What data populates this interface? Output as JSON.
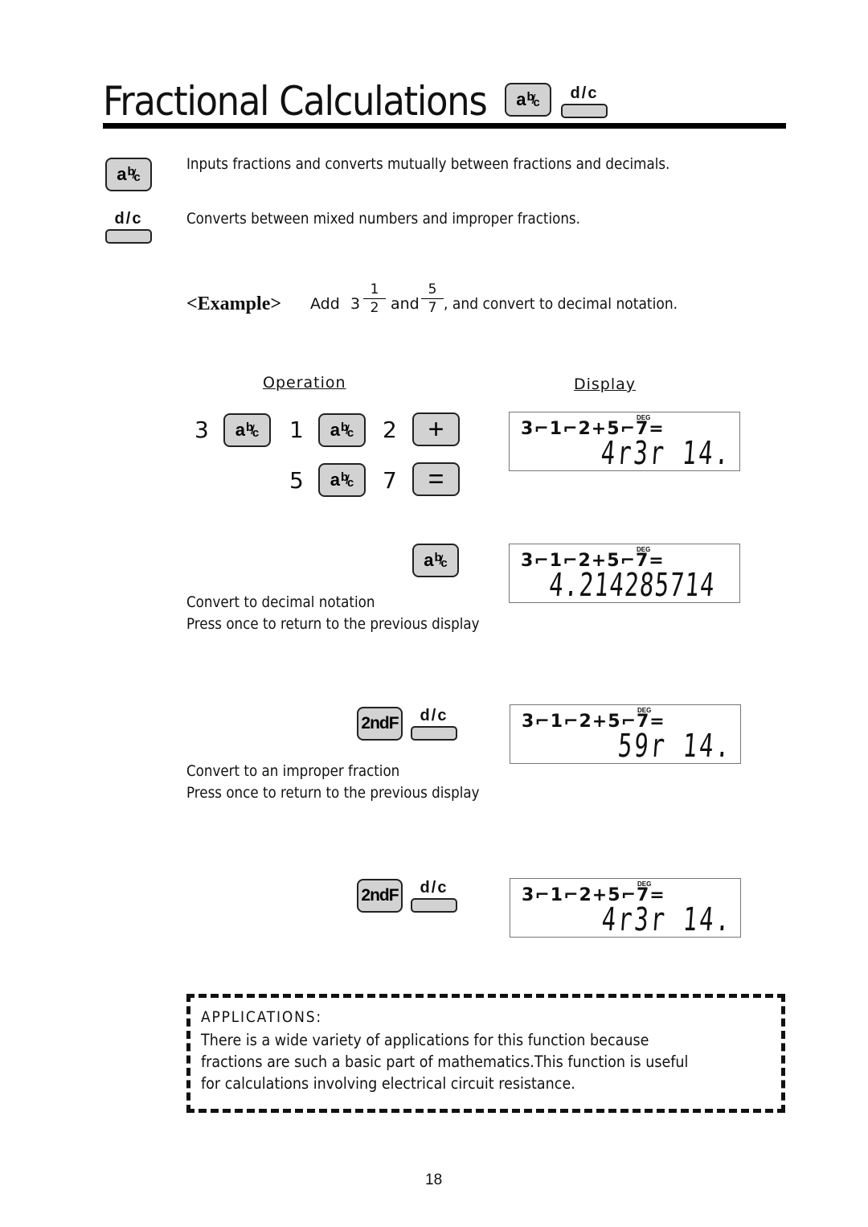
{
  "header": {
    "title": "Fractional Calculations",
    "key_abc": {
      "a": "a",
      "b": "b",
      "slash": "/",
      "c": "c"
    },
    "key_dc": "d/c"
  },
  "definitions": [
    {
      "key": "a b/c",
      "text": "Inputs fractions and converts mutually between fractions and decimals."
    },
    {
      "key": "d/c",
      "text": "Converts between mixed numbers and improper fractions."
    }
  ],
  "example": {
    "label": "<Example>",
    "add": "Add",
    "whole": "3",
    "frac1": {
      "num": "1",
      "den": "2"
    },
    "and": "and",
    "frac2": {
      "num": "5",
      "den": "7"
    },
    "tail": ", and convert to decimal notation."
  },
  "columns": {
    "operation": "Operation",
    "display": "Display"
  },
  "operation": {
    "row1": [
      "3",
      "1",
      "2"
    ],
    "row2": [
      "5",
      "7"
    ],
    "plus": "+",
    "equals": "=",
    "second_f": "2ndF"
  },
  "steps": [
    {
      "display": {
        "indicator": "DEG",
        "line1": "3⌐1⌐2+5⌐7=",
        "line2": "4r3r 14."
      }
    },
    {
      "display": {
        "indicator": "DEG",
        "line1": "3⌐1⌐2+5⌐7=",
        "line2": "4.214285714"
      },
      "notes": [
        "Convert to decimal notation",
        "Press once to return to the previous display"
      ]
    },
    {
      "display": {
        "indicator": "DEG",
        "line1": "3⌐1⌐2+5⌐7=",
        "line2": "59r 14."
      },
      "notes": [
        "Convert to an improper fraction",
        "Press once to return to the previous display"
      ]
    },
    {
      "display": {
        "indicator": "DEG",
        "line1": "3⌐1⌐2+5⌐7=",
        "line2": "4r3r 14."
      }
    }
  ],
  "applications": {
    "title": "APPLICATIONS:",
    "lines": [
      "There is a wide variety of applications for this function because",
      "fractions are such a basic part of mathematics.This function is useful",
      "for calculations involving electrical circuit resistance."
    ]
  },
  "page_number": "18"
}
